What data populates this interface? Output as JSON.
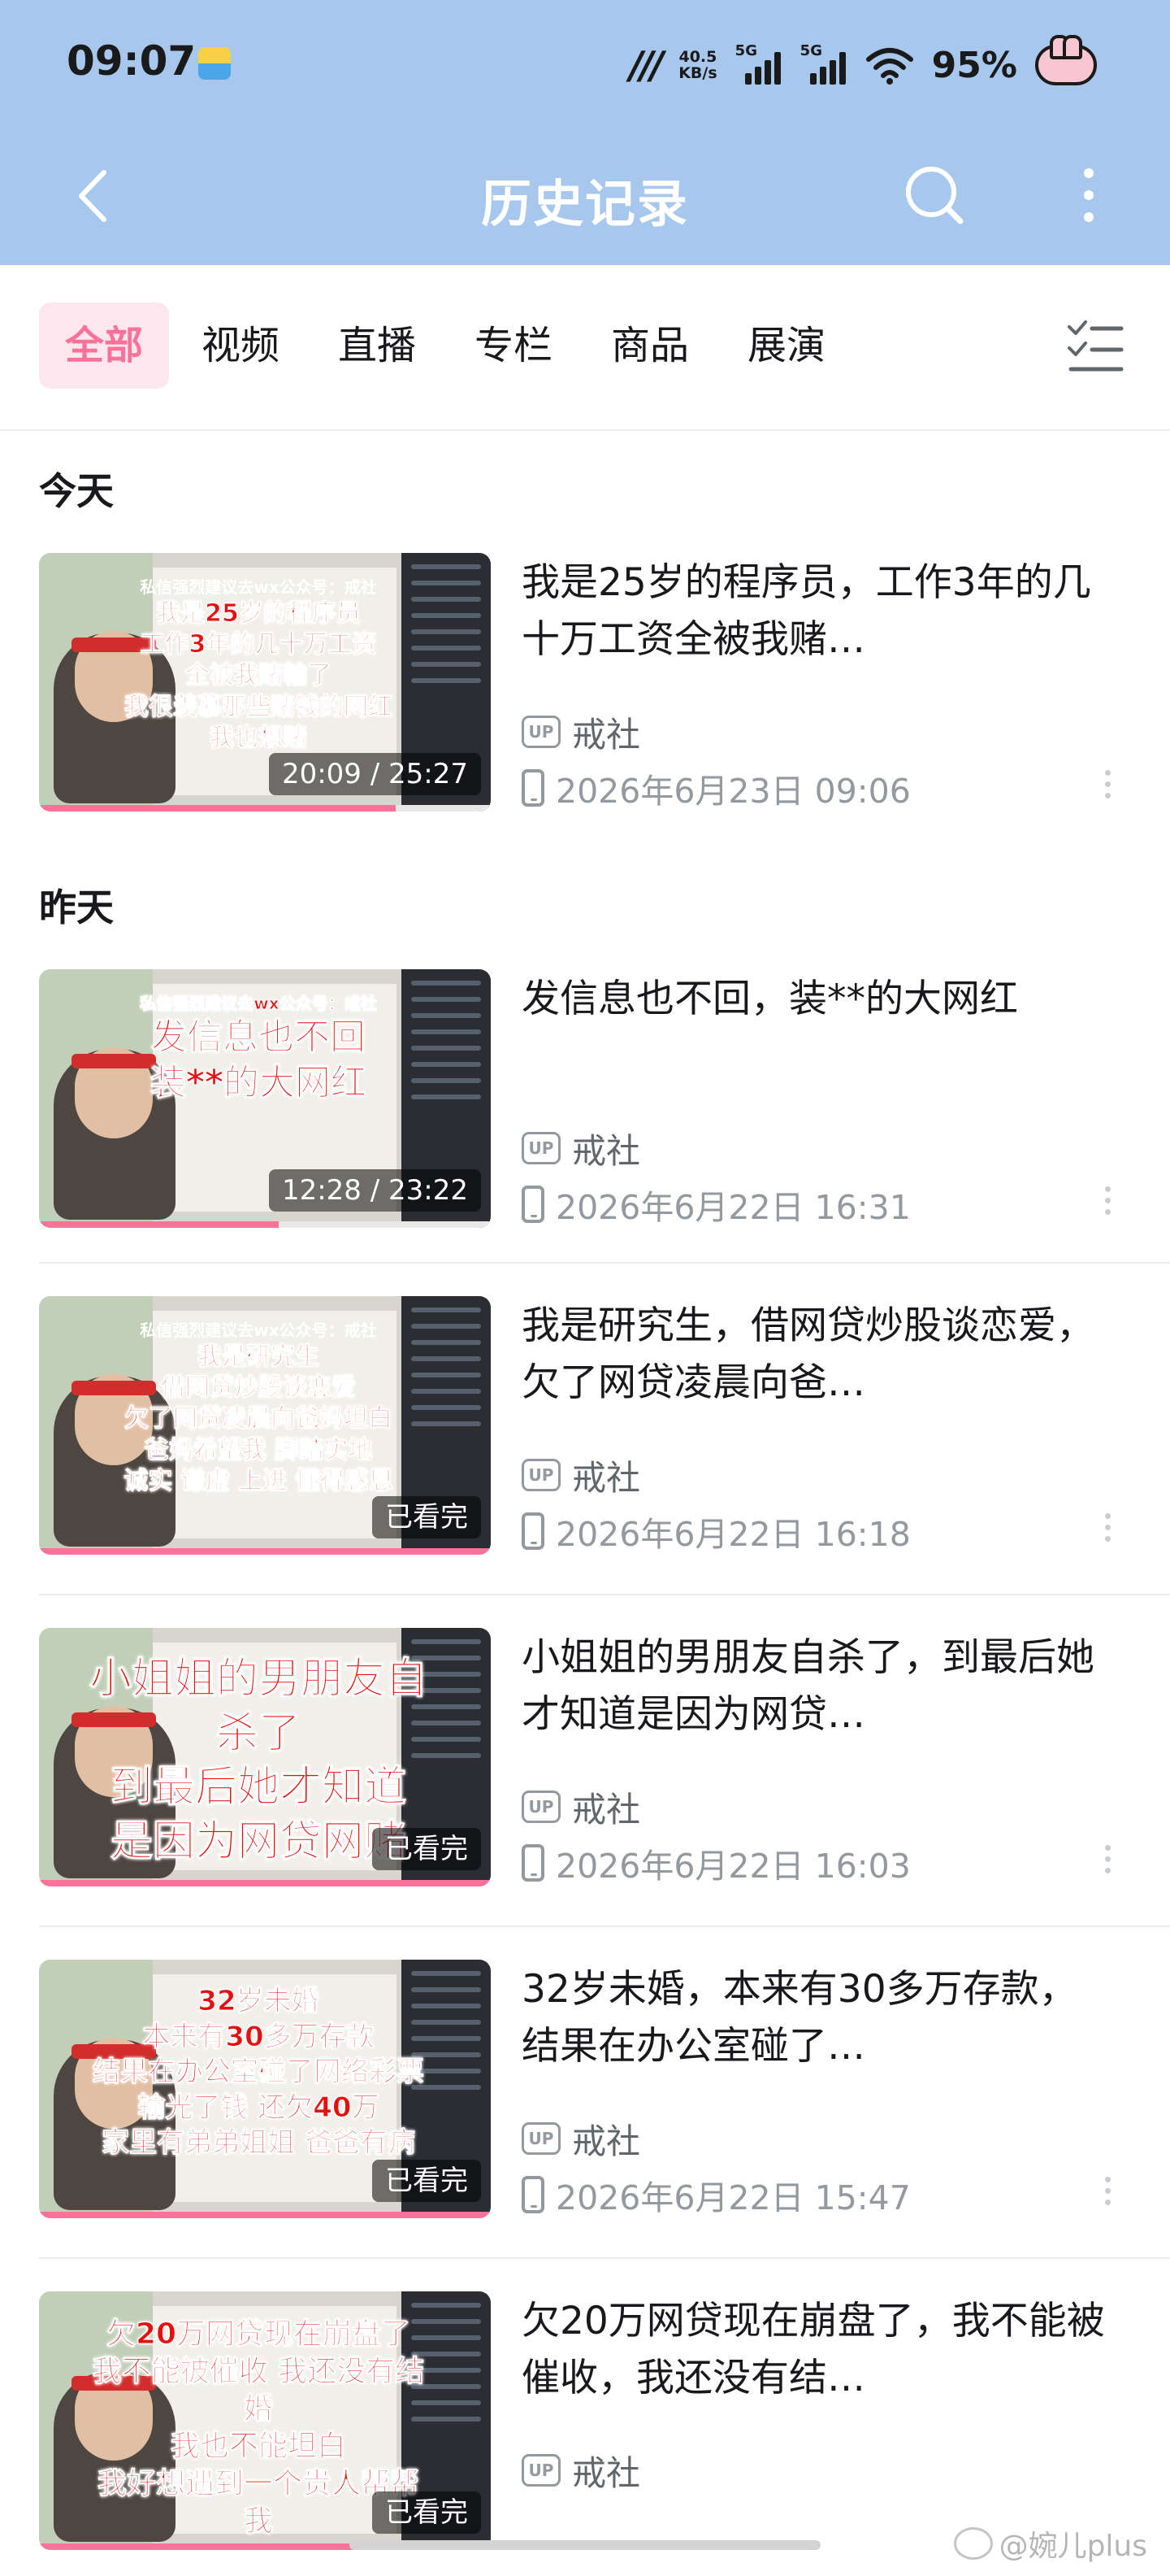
{
  "status_bar": {
    "time": "09:07",
    "net_speed_value": "40.5",
    "net_speed_unit": "KB/s",
    "signal1": "5G",
    "signal2": "5G",
    "battery": "95%"
  },
  "header": {
    "title": "历史记录"
  },
  "tabs": [
    {
      "label": "全部",
      "active": true
    },
    {
      "label": "视频"
    },
    {
      "label": "直播"
    },
    {
      "label": "专栏"
    },
    {
      "label": "商品"
    },
    {
      "label": "展演"
    }
  ],
  "sections": [
    {
      "label": "今天"
    },
    {
      "label": "昨天"
    }
  ],
  "items": [
    {
      "title": "我是25岁的程序员，工作3年的几十万工资全被我赌…",
      "uploader": "戒社",
      "time": "2026年6月23日 09:06",
      "badge": "20:09 / 25:27",
      "progress": 0.79,
      "overlay": [
        "私信强烈建议去wx公众号：戒社",
        "我是25岁的程序员",
        "工作3年的几十万工资",
        "全被我赌輸了",
        "我很羡慕那些赌钱的网红",
        "我也想赌"
      ]
    },
    {
      "title": "发信息也不回，装**的大网红",
      "uploader": "戒社",
      "time": "2026年6月22日 16:31",
      "badge": "12:28 / 23:22",
      "progress": 0.53,
      "overlay": [
        "私信强烈建议去wx公众号：戒社",
        "发信息也不回",
        "装**的大网红"
      ]
    },
    {
      "title": "我是研究生，借网贷炒股谈恋爱，欠了网贷凌晨向爸…",
      "uploader": "戒社",
      "time": "2026年6月22日 16:18",
      "badge": "已看完",
      "progress": 1,
      "overlay": [
        "私信强烈建议去wx公众号：戒社",
        "我是研究生",
        "借网贷炒股谈恋爱",
        "欠了网贷凌晨向爸妈坦白",
        "爸妈希望我 脚踏实地",
        "诚实 谦虚 上进 懂得感恩"
      ]
    },
    {
      "title": "小姐姐的男朋友自杀了，到最后她才知道是因为网贷…",
      "uploader": "戒社",
      "time": "2026年6月22日 16:03",
      "badge": "已看完",
      "progress": 1,
      "overlay": [
        "小姐姐的男朋友自杀了",
        "到最后她才知道",
        "是因为网贷网赌"
      ]
    },
    {
      "title": "32岁未婚，本来有30多万存款，结果在办公室碰了…",
      "uploader": "戒社",
      "time": "2026年6月22日 15:47",
      "badge": "已看完",
      "progress": 1,
      "overlay": [
        "32岁未婚",
        "本来有30多万存款",
        "结果在办公室碰了网络彩票",
        "输光了钱 还欠40万",
        "家里有弟弟姐姐 爸爸有病"
      ]
    },
    {
      "title": "欠20万网贷现在崩盘了，我不能被催收，我还没有结…",
      "uploader": "戒社",
      "time": "",
      "badge": "已看完",
      "progress": 1,
      "overlay": [
        "欠20万网贷现在崩盘了",
        "我不能被催收 我还没有结婚",
        "我也不能坦白",
        "我好想遇到一个贵人帮帮我"
      ]
    }
  ],
  "labels": {
    "up": "UP"
  },
  "watermark": "@婉儿plus",
  "colors": {
    "accent": "#fb7299",
    "header_bg": "#a7c7ec",
    "overlay_text": "#e60f0f"
  },
  "icons": [
    "back-icon",
    "search-icon",
    "more-vertical-icon",
    "filter-list-icon",
    "up-badge-icon",
    "phone-icon",
    "wifi-icon",
    "avatar-icon"
  ]
}
